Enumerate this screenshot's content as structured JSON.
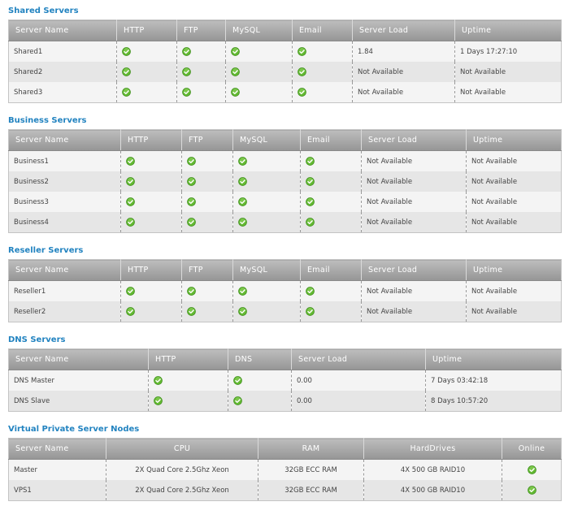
{
  "shared": {
    "title": "Shared Servers",
    "headers": [
      "Server Name",
      "HTTP",
      "FTP",
      "MySQL",
      "Email",
      "Server Load",
      "Uptime"
    ],
    "rows": [
      {
        "name": "Shared1",
        "load": "1.84",
        "uptime": "1 Days 17:27:10"
      },
      {
        "name": "Shared2",
        "load": "Not Available",
        "uptime": "Not Available"
      },
      {
        "name": "Shared3",
        "load": "Not Available",
        "uptime": "Not Available"
      }
    ]
  },
  "business": {
    "title": "Business Servers",
    "headers": [
      "Server Name",
      "HTTP",
      "FTP",
      "MySQL",
      "Email",
      "Server Load",
      "Uptime"
    ],
    "rows": [
      {
        "name": "Business1",
        "load": "Not Available",
        "uptime": "Not Available"
      },
      {
        "name": "Business2",
        "load": "Not Available",
        "uptime": "Not Available"
      },
      {
        "name": "Business3",
        "load": "Not Available",
        "uptime": "Not Available"
      },
      {
        "name": "Business4",
        "load": "Not Available",
        "uptime": "Not Available"
      }
    ]
  },
  "reseller": {
    "title": "Reseller Servers",
    "headers": [
      "Server Name",
      "HTTP",
      "FTP",
      "MySQL",
      "Email",
      "Server Load",
      "Uptime"
    ],
    "rows": [
      {
        "name": "Reseller1",
        "load": "Not Available",
        "uptime": "Not Available"
      },
      {
        "name": "Reseller2",
        "load": "Not Available",
        "uptime": "Not Available"
      }
    ]
  },
  "dns": {
    "title": "DNS Servers",
    "headers": [
      "Server Name",
      "HTTP",
      "DNS",
      "Server Load",
      "Uptime"
    ],
    "rows": [
      {
        "name": "DNS Master",
        "load": "0.00",
        "uptime": "7 Days 03:42:18"
      },
      {
        "name": "DNS Slave",
        "load": "0.00",
        "uptime": "8 Days 10:57:20"
      }
    ]
  },
  "vps": {
    "title": "Virtual Private Server Nodes",
    "headers": [
      "Server Name",
      "CPU",
      "RAM",
      "HardDrives",
      "Online"
    ],
    "rows": [
      {
        "name": "Master",
        "cpu": "2X Quad Core 2.5Ghz Xeon",
        "ram": "32GB ECC RAM",
        "drives": "4X 500 GB RAID10"
      },
      {
        "name": "VPS1",
        "cpu": "2X Quad Core 2.5Ghz Xeon",
        "ram": "32GB ECC RAM",
        "drives": "4X 500 GB RAID10"
      }
    ]
  },
  "status_icon": {
    "name": "check-circle-icon",
    "color": "#5cb82e"
  }
}
